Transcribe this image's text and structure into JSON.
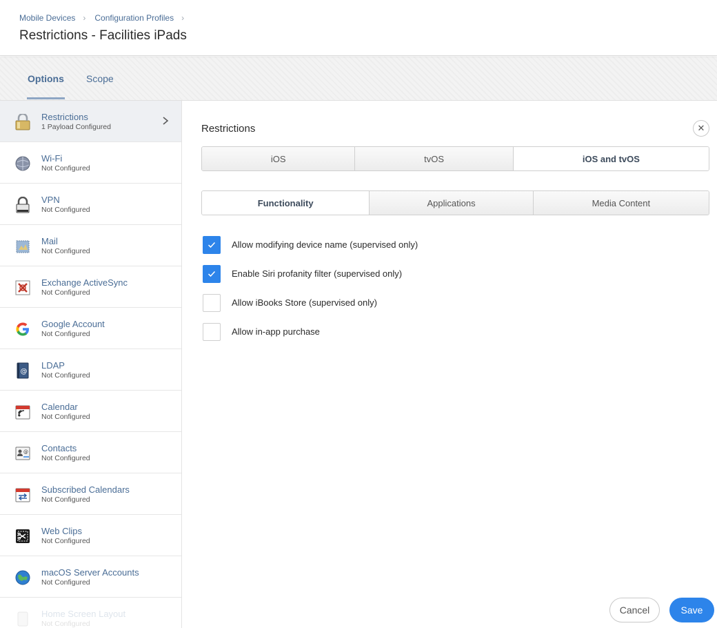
{
  "breadcrumb": {
    "items": [
      "Mobile Devices",
      "Configuration Profiles"
    ],
    "separator": "›"
  },
  "page": {
    "title": "Restrictions - Facilities iPads"
  },
  "tabs": {
    "options": "Options",
    "scope": "Scope",
    "active": "Options"
  },
  "sidebar": {
    "items": [
      {
        "label": "Restrictions",
        "status": "1 Payload Configured",
        "icon": "lock-icon",
        "selected": true
      },
      {
        "label": "Wi-Fi",
        "status": "Not Configured",
        "icon": "wifi-globe-icon"
      },
      {
        "label": "VPN",
        "status": "Not Configured",
        "icon": "vpn-lock-icon"
      },
      {
        "label": "Mail",
        "status": "Not Configured",
        "icon": "mail-stamp-icon"
      },
      {
        "label": "Exchange ActiveSync",
        "status": "Not Configured",
        "icon": "exchange-icon"
      },
      {
        "label": "Google Account",
        "status": "Not Configured",
        "icon": "google-icon"
      },
      {
        "label": "LDAP",
        "status": "Not Configured",
        "icon": "ldap-book-icon"
      },
      {
        "label": "Calendar",
        "status": "Not Configured",
        "icon": "calendar-icon"
      },
      {
        "label": "Contacts",
        "status": "Not Configured",
        "icon": "contacts-icon"
      },
      {
        "label": "Subscribed Calendars",
        "status": "Not Configured",
        "icon": "subscribed-calendar-icon"
      },
      {
        "label": "Web Clips",
        "status": "Not Configured",
        "icon": "web-clip-icon"
      },
      {
        "label": "macOS Server Accounts",
        "status": "Not Configured",
        "icon": "server-globe-icon"
      },
      {
        "label": "Home Screen Layout",
        "status": "Not Configured",
        "icon": "home-screen-icon"
      }
    ]
  },
  "main": {
    "title": "Restrictions",
    "platform_tabs": [
      "iOS",
      "tvOS",
      "iOS and tvOS"
    ],
    "platform_active": "iOS and tvOS",
    "category_tabs": [
      "Functionality",
      "Applications",
      "Media Content"
    ],
    "category_active": "Functionality",
    "options": [
      {
        "label": "Allow modifying device name (supervised only)",
        "checked": true
      },
      {
        "label": "Enable Siri profanity filter (supervised only)",
        "checked": true
      },
      {
        "label": "Allow iBooks Store (supervised only)",
        "checked": false
      },
      {
        "label": "Allow in-app purchase",
        "checked": false
      }
    ]
  },
  "footer": {
    "cancel_label": "Cancel",
    "save_label": "Save"
  },
  "colors": {
    "accent": "#2d84ea",
    "link": "#4a6d96"
  }
}
